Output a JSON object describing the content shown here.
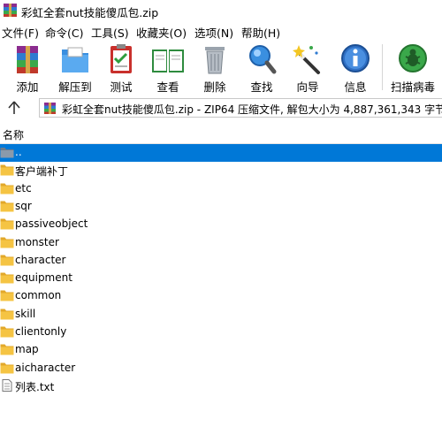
{
  "window": {
    "title": "彩虹全套nut技能傻瓜包.zip"
  },
  "menu": [
    "文件(F)",
    "命令(C)",
    "工具(S)",
    "收藏夹(O)",
    "选项(N)",
    "帮助(H)"
  ],
  "toolbar": [
    {
      "label": "添加",
      "icon": "add-archive-icon"
    },
    {
      "label": "解压到",
      "icon": "extract-folder-icon"
    },
    {
      "label": "测试",
      "icon": "test-clipboard-icon"
    },
    {
      "label": "查看",
      "icon": "view-book-icon"
    },
    {
      "label": "删除",
      "icon": "delete-trash-icon"
    },
    {
      "label": "查找",
      "icon": "find-magnifier-icon"
    },
    {
      "label": "向导",
      "icon": "wizard-wand-icon"
    },
    {
      "label": "信息",
      "icon": "info-icon"
    },
    {
      "label": "扫描病毒",
      "icon": "virus-scan-icon"
    }
  ],
  "address": {
    "text": "彩虹全套nut技能傻瓜包.zip - ZIP64 压缩文件, 解包大小为 4,887,361,343 字节"
  },
  "columns": {
    "name": "名称"
  },
  "files": [
    {
      "name": "..",
      "type": "parent",
      "selected": true
    },
    {
      "name": "客户端补丁",
      "type": "folder"
    },
    {
      "name": "etc",
      "type": "folder"
    },
    {
      "name": "sqr",
      "type": "folder"
    },
    {
      "name": "passiveobject",
      "type": "folder"
    },
    {
      "name": "monster",
      "type": "folder"
    },
    {
      "name": "character",
      "type": "folder"
    },
    {
      "name": "equipment",
      "type": "folder"
    },
    {
      "name": "common",
      "type": "folder"
    },
    {
      "name": "skill",
      "type": "folder"
    },
    {
      "name": "clientonly",
      "type": "folder"
    },
    {
      "name": "map",
      "type": "folder"
    },
    {
      "name": "aicharacter",
      "type": "folder"
    },
    {
      "name": "列表.txt",
      "type": "text-file"
    }
  ],
  "colors": {
    "selection": "#0078d7",
    "folder": "#f5c443"
  }
}
